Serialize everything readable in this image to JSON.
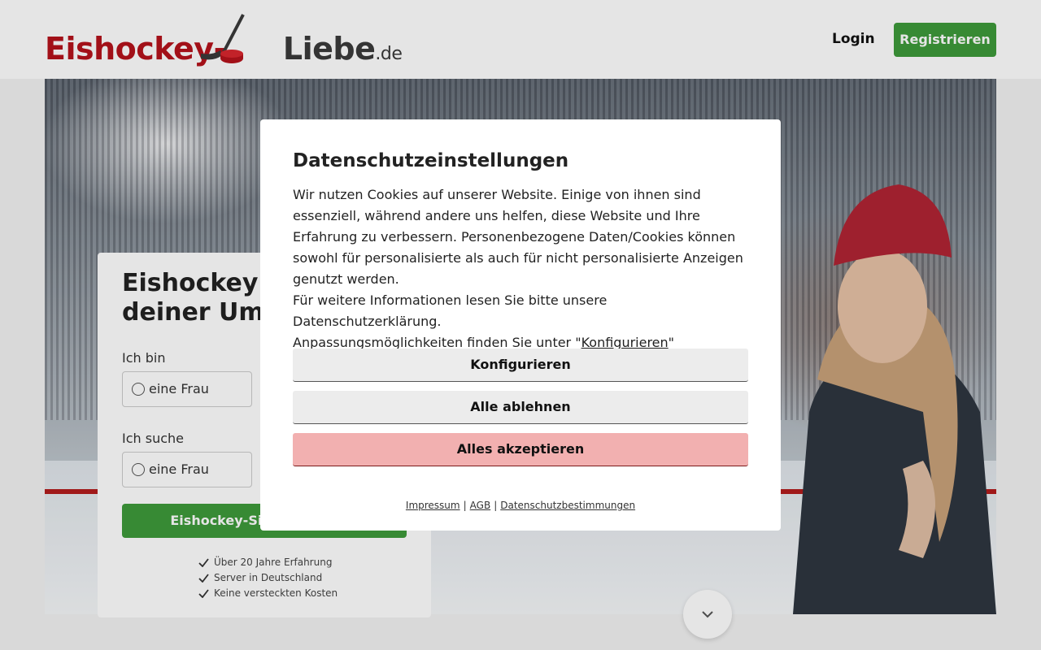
{
  "header": {
    "logo": {
      "main": "Eishockey-",
      "second": "Liebe",
      "tld": ".de"
    },
    "login_label": "Login",
    "register_label": "Registrieren"
  },
  "search": {
    "title": "Eishockey Fans in deiner Umgebung",
    "i_am_label": "Ich bin",
    "i_am_option": "eine Frau",
    "looking_for_label": "Ich suche",
    "looking_for_option": "eine Frau",
    "button_label": "Eishockey-Singles suchen",
    "benefits": [
      "Über 20 Jahre Erfahrung",
      "Server in Deutschland",
      "Keine versteckten Kosten"
    ]
  },
  "modal": {
    "title": "Datenschutzeinstellungen",
    "paragraph1": "Wir nutzen Cookies auf unserer Website. Einige von ihnen sind essenziell, während andere uns helfen, diese Website und Ihre Erfahrung zu verbessern. Personenbezogene Daten/Cookies können sowohl für personalisierte als auch für nicht personalisierte Anzeigen genutzt werden.",
    "paragraph2": "Für weitere Informationen lesen Sie bitte unsere Datenschutzerklärung.",
    "paragraph3_prefix": "Anpassungsmöglichkeiten finden Sie unter \"",
    "paragraph3_link": "Konfigurieren",
    "paragraph3_suffix": "\"",
    "configure_label": "Konfigurieren",
    "reject_label": "Alle ablehnen",
    "accept_label": "Alles akzeptieren",
    "footer_links": {
      "imprint": "Impressum",
      "terms": "AGB",
      "privacy": "Datenschutzbestimmungen",
      "separator": "|"
    }
  },
  "colors": {
    "brand_red": "#b5121b",
    "brand_green": "#3e9a3a",
    "accept_pink": "#f2b0b0"
  },
  "icons": {
    "scroll": "chevron-down-icon",
    "benefit": "check-icon",
    "logo": "hockey-stick-icon"
  }
}
